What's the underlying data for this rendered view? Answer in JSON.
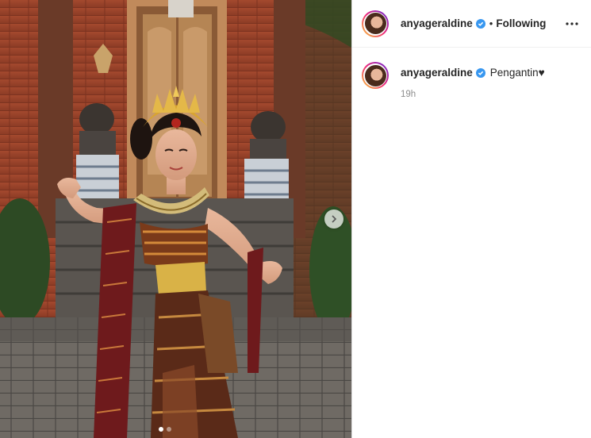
{
  "post": {
    "username": "anyageraldine",
    "separator": "•",
    "follow_status": "Following",
    "caption_username": "anyageraldine",
    "caption": "Pengantin♥",
    "time_ago": "19h",
    "carousel_count": 2,
    "carousel_active": 1
  },
  "icons": {
    "verified": "verified-badge-icon",
    "more": "more-options-icon",
    "next": "chevron-right-icon"
  },
  "colors": {
    "verified": "#3897f0",
    "muted": "#8e8e8e",
    "text": "#262626"
  }
}
